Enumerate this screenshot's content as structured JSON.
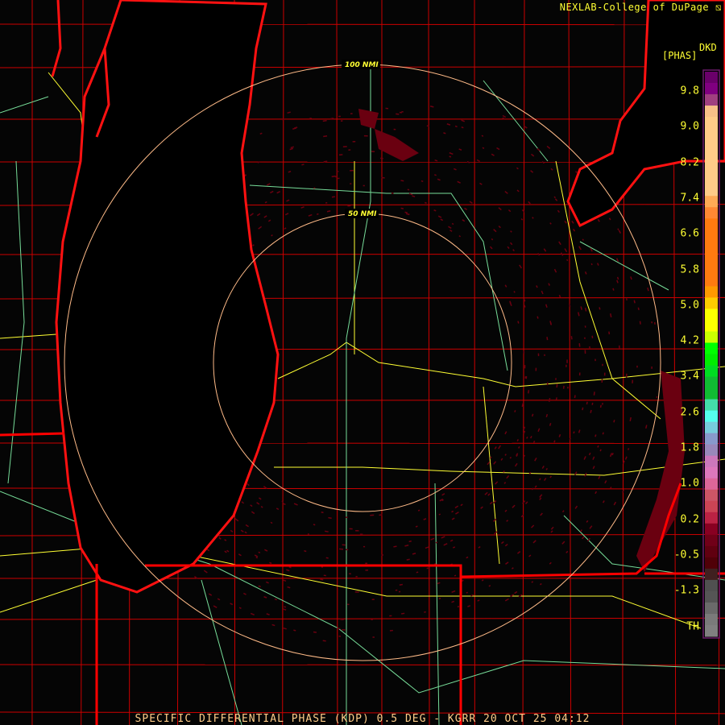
{
  "header": {
    "credit": "NEXLAB-College of DuPage",
    "credit_logo": "cod-logo-icon"
  },
  "legend": {
    "product": "DKD",
    "unit": "[PHAS]",
    "ticks": [
      "9.8",
      "9.0",
      "8.2",
      "7.4",
      "6.6",
      "5.8",
      "5.0",
      "4.2",
      "3.4",
      "2.6",
      "1.8",
      "1.0",
      "0.2",
      "-0.5",
      "-1.3",
      "TH"
    ],
    "colors": [
      "#6a006a",
      "#800080",
      "#a04080",
      "#f8c088",
      "#ffcc88",
      "#ffcc88",
      "#ffcc88",
      "#ffcc88",
      "#ffcc88",
      "#ffcc88",
      "#ffcc88",
      "#ffaa55",
      "#ff8833",
      "#ff7a10",
      "#ff7a10",
      "#ff7a10",
      "#ff7a10",
      "#ff7a10",
      "#ff7a10",
      "#ff9900",
      "#ffcc00",
      "#ffff00",
      "#ffff00",
      "#ccff00",
      "#00ff00",
      "#00ee00",
      "#00dd22",
      "#11bb33",
      "#11bb33",
      "#44ddaa",
      "#55ffee",
      "#77ccdd",
      "#8899cc",
      "#9988bb",
      "#cc77bb",
      "#dd77bb",
      "#dd6699",
      "#cc5566",
      "#cc4455",
      "#bb2244",
      "#880022",
      "#700018",
      "#600010",
      "#500008",
      "#402020",
      "#505050",
      "#555555",
      "#6a6a6a",
      "#7a7a7a",
      "#808080"
    ]
  },
  "map": {
    "range_rings": [
      "100 NMI",
      "50 NMI"
    ],
    "colors": {
      "state_border": "#ff0000",
      "county": "#cc0000",
      "highway": "#ffff33",
      "road": "#77dd99",
      "ring": "#ffbb88",
      "echo": "#6a0010"
    }
  },
  "footer": {
    "caption": "SPECIFIC DIFFERENTIAL PHASE (KDP) 0.5 DEG - KGRR 20 OCT 25 04:12"
  }
}
